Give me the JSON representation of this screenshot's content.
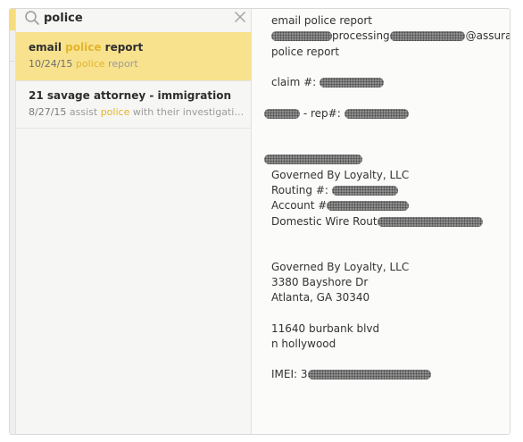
{
  "search": {
    "query": "police",
    "icon": "magnifier-icon",
    "clear_icon": "close-icon"
  },
  "notes_list": [
    {
      "title_pre": "email ",
      "title_hl": "police",
      "title_post": " report",
      "date": "10/24/15",
      "snippet_hl": "police",
      "snippet_post": " report",
      "selected": true
    },
    {
      "title": "21 savage attorney - immigration",
      "date": "8/27/15",
      "snippet_pre": " assist ",
      "snippet_hl": "police",
      "snippet_post": " with their investigati…",
      "selected": false
    }
  ],
  "note_body": {
    "line1": "email police report",
    "line2_suffix": "assurant.com",
    "line2_mid": "processing",
    "line3": "police report",
    "line4": "claim #:",
    "line5": "- rep#:",
    "line7": "Governed By Loyalty, LLC",
    "line8": "Routing #:",
    "line9": "Account #",
    "line10": "Domestic Wire Rout",
    "line11": "Governed By Loyalty, LLC",
    "line12": "3380 Bayshore Dr",
    "line13": "Atlanta, GA 30340",
    "line14": "11640 burbank blvd",
    "line15": "n hollywood",
    "line16": "IMEI: 3"
  },
  "colors": {
    "selected_row": "#f8e28d",
    "highlight": "#e2b52c"
  }
}
